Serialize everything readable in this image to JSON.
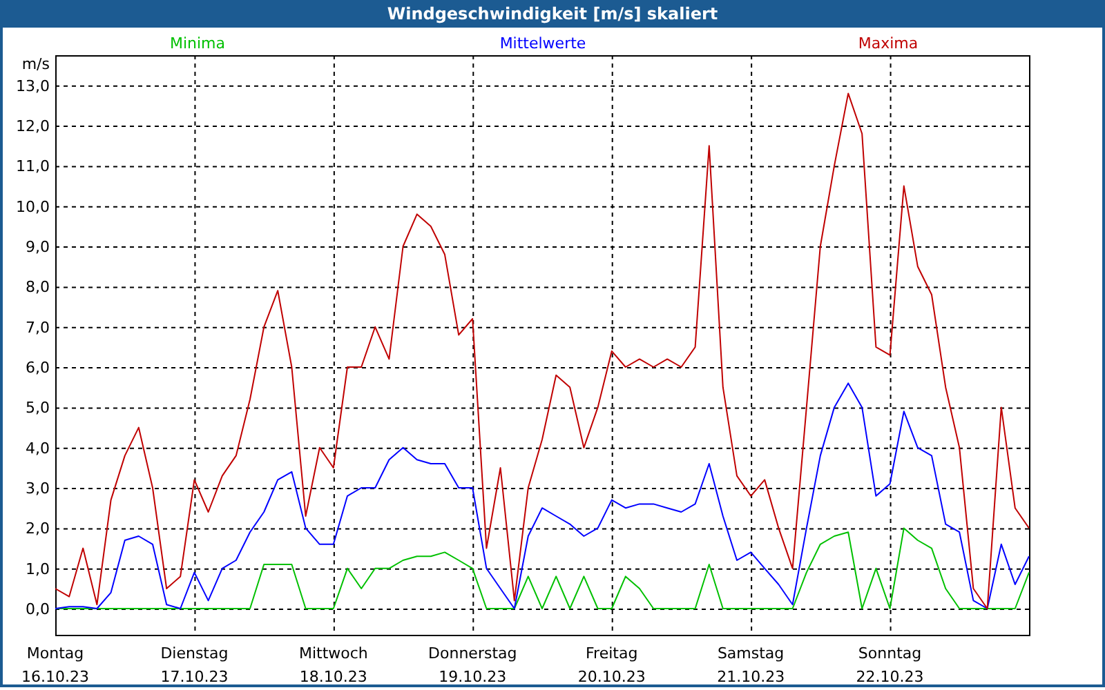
{
  "window": {
    "title": "Windgeschwindigkeit [m/s] skaliert"
  },
  "chart": {
    "chart_data": {
      "type": "line",
      "grid": true,
      "ylabel": "m/s",
      "categories": [
        "Montag",
        null,
        null,
        null,
        null,
        null,
        null,
        null,
        null,
        null,
        "Dienstag",
        null,
        null,
        null,
        null,
        null,
        null,
        null,
        null,
        null,
        "Mittwoch",
        null,
        null,
        null,
        null,
        null,
        null,
        null,
        null,
        null,
        "Donnerstag",
        null,
        null,
        null,
        null,
        null,
        null,
        null,
        null,
        null,
        "Freitag",
        null,
        null,
        null,
        null,
        null,
        null,
        null,
        null,
        null,
        "Samstag",
        null,
        null,
        null,
        null,
        null,
        null,
        null,
        null,
        null,
        "Sonntag",
        null,
        null,
        null,
        null,
        null,
        null,
        null,
        null,
        null,
        null
      ],
      "series": [
        {
          "name": "Minima",
          "color": "#00c000",
          "values": [
            0,
            0,
            0,
            0,
            0,
            0,
            0,
            0,
            0,
            0,
            0,
            0,
            0,
            0,
            0,
            1.1,
            1.1,
            1.1,
            0,
            0,
            0,
            1.0,
            0.5,
            1.0,
            1.0,
            1.2,
            1.3,
            1.3,
            1.4,
            1.2,
            1.0,
            0,
            0,
            0,
            0.8,
            0,
            0.8,
            0,
            0.8,
            0,
            0,
            0.8,
            0.5,
            0,
            0,
            0,
            0,
            1.1,
            0,
            0,
            0,
            0,
            0,
            0,
            0.9,
            1.6,
            1.8,
            1.9,
            0,
            1.0,
            0,
            2.0,
            1.7,
            1.5,
            0.5,
            0,
            0,
            0,
            0,
            0,
            0.9
          ]
        },
        {
          "name": "Mittelwerte",
          "color": "#0000ff",
          "values": [
            0,
            0.05,
            0.05,
            0,
            0.4,
            1.7,
            1.8,
            1.6,
            0.1,
            0,
            0.9,
            0.2,
            1.0,
            1.2,
            1.9,
            2.4,
            3.2,
            3.4,
            2.0,
            1.6,
            1.6,
            2.8,
            3.0,
            3.0,
            3.7,
            4.0,
            3.7,
            3.6,
            3.6,
            3.0,
            3.0,
            1.0,
            0.5,
            0,
            1.8,
            2.5,
            2.3,
            2.1,
            1.8,
            2.0,
            2.7,
            2.5,
            2.6,
            2.6,
            2.5,
            2.4,
            2.6,
            3.6,
            2.3,
            1.2,
            1.4,
            1.0,
            0.6,
            0.1,
            2.0,
            3.8,
            5.0,
            5.6,
            5.0,
            2.8,
            3.1,
            4.9,
            4.0,
            3.8,
            2.1,
            1.9,
            0.2,
            0,
            1.6,
            0.6,
            1.3
          ]
        },
        {
          "name": "Maxima",
          "color": "#c00000",
          "values": [
            0.5,
            0.3,
            1.5,
            0.1,
            2.7,
            3.8,
            4.5,
            3.0,
            0.5,
            0.8,
            3.2,
            2.4,
            3.3,
            3.8,
            5.2,
            7.0,
            7.9,
            6.0,
            2.3,
            4.0,
            3.5,
            6.0,
            6.0,
            7.0,
            6.2,
            9.0,
            9.8,
            9.5,
            8.8,
            6.8,
            7.2,
            1.5,
            3.5,
            0.2,
            3.0,
            4.2,
            5.8,
            5.5,
            4.0,
            5.0,
            6.4,
            6.0,
            6.2,
            6.0,
            6.2,
            6.0,
            6.5,
            11.5,
            5.5,
            3.3,
            2.8,
            3.2,
            2.0,
            1.0,
            5.0,
            9.0,
            11.0,
            12.8,
            11.8,
            6.5,
            6.3,
            10.5,
            8.5,
            7.8,
            5.5,
            4.0,
            0.5,
            0,
            5.0,
            2.5,
            2.0
          ]
        }
      ],
      "ylim": [
        -0.65,
        13.75
      ],
      "yticks": [
        {
          "value": 0,
          "label": "0,0"
        },
        {
          "value": 1,
          "label": "1,0"
        },
        {
          "value": 2,
          "label": "2,0"
        },
        {
          "value": 3,
          "label": "3,0"
        },
        {
          "value": 4,
          "label": "4,0"
        },
        {
          "value": 5,
          "label": "5,0"
        },
        {
          "value": 6,
          "label": "6,0"
        },
        {
          "value": 7,
          "label": "7,0"
        },
        {
          "value": 8,
          "label": "8,0"
        },
        {
          "value": 9,
          "label": "9,0"
        },
        {
          "value": 10,
          "label": "10,0"
        },
        {
          "value": 11,
          "label": "11,0"
        },
        {
          "value": 12,
          "label": "12,0"
        },
        {
          "value": 13,
          "label": "13,0"
        }
      ]
    },
    "dates": [
      "16.10.23",
      "17.10.23",
      "18.10.23",
      "19.10.23",
      "20.10.23",
      "21.10.23",
      "22.10.23"
    ]
  }
}
